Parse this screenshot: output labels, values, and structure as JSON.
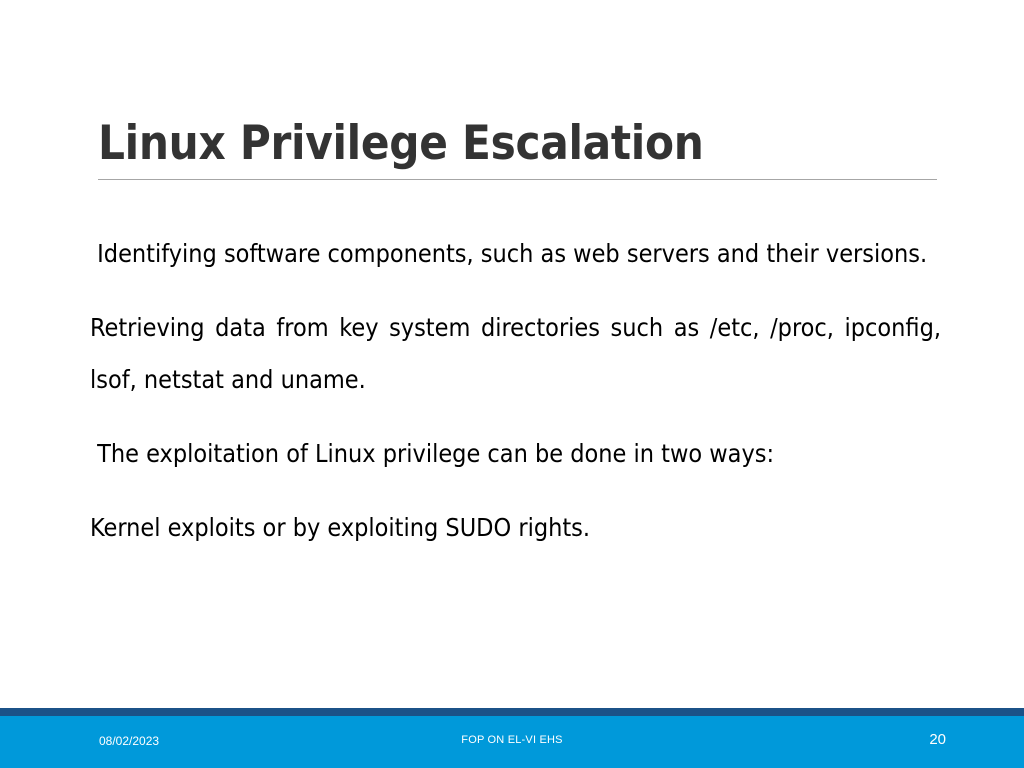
{
  "slide": {
    "title": "Linux Privilege Escalation",
    "background_color": "#ffffff",
    "title_color": "#333333",
    "rule_color": "#a6a6a6"
  },
  "body": {
    "paragraphs": [
      " Identifying software components, such as web servers and their versions.",
      "Retrieving data from key system directories such as /etc, /proc, ipconfig, lsof, netstat and uname.",
      " The exploitation of Linux privilege can be done in two ways:",
      "Kernel exploits or by exploiting SUDO rights."
    ]
  },
  "footer": {
    "date": "08/02/2023",
    "center_text": "FOP ON EL-VI EHS",
    "page_number": "20",
    "strip_color": "#1b5288",
    "band_color": "#0099da",
    "text_color": "#ffffff"
  }
}
